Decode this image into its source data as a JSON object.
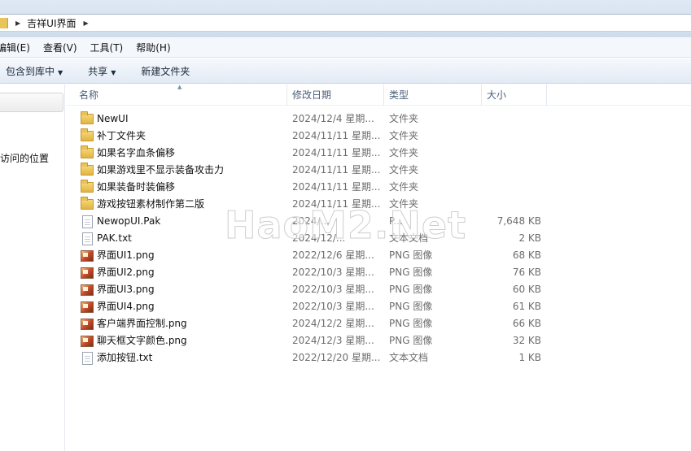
{
  "address": {
    "path": "吉祥UI界面"
  },
  "menu": [
    "编辑(E)",
    "查看(V)",
    "工具(T)",
    "帮助(H)"
  ],
  "toolbar": {
    "include_library": "包含到库中",
    "share": "共享",
    "new_folder": "新建文件夹"
  },
  "nav": {
    "recent_places": "访问的位置"
  },
  "columns": {
    "name": "名称",
    "date": "修改日期",
    "type": "类型",
    "size": "大小"
  },
  "files": [
    {
      "icon": "folder-icon",
      "name": "NewUI",
      "date": "2024/12/4 星期...",
      "type": "文件夹",
      "size": ""
    },
    {
      "icon": "folder-icon",
      "name": "补丁文件夹",
      "date": "2024/11/11 星期...",
      "type": "文件夹",
      "size": ""
    },
    {
      "icon": "folder-icon",
      "name": "如果名字血条偏移",
      "date": "2024/11/11 星期...",
      "type": "文件夹",
      "size": ""
    },
    {
      "icon": "folder-icon",
      "name": "如果游戏里不显示装备攻击力",
      "date": "2024/11/11 星期...",
      "type": "文件夹",
      "size": ""
    },
    {
      "icon": "folder-icon",
      "name": "如果装备时装偏移",
      "date": "2024/11/11 星期...",
      "type": "文件夹",
      "size": ""
    },
    {
      "icon": "folder-icon",
      "name": "游戏按钮素材制作第二版",
      "date": "2024/11/11 星期...",
      "type": "文件夹",
      "size": ""
    },
    {
      "icon": "file-icon",
      "name": "NewopUI.Pak",
      "date": "2024/...",
      "type": "P...",
      "size": "7,648 KB"
    },
    {
      "icon": "text-file-icon",
      "name": "PAK.txt",
      "date": "2024/12/...",
      "type": "文本文档",
      "size": "2 KB"
    },
    {
      "icon": "image-file-icon",
      "name": "界面UI1.png",
      "date": "2022/12/6 星期...",
      "type": "PNG 图像",
      "size": "68 KB"
    },
    {
      "icon": "image-file-icon",
      "name": "界面UI2.png",
      "date": "2022/10/3 星期...",
      "type": "PNG 图像",
      "size": "76 KB"
    },
    {
      "icon": "image-file-icon",
      "name": "界面UI3.png",
      "date": "2022/10/3 星期...",
      "type": "PNG 图像",
      "size": "60 KB"
    },
    {
      "icon": "image-file-icon",
      "name": "界面UI4.png",
      "date": "2022/10/3 星期...",
      "type": "PNG 图像",
      "size": "61 KB"
    },
    {
      "icon": "image-file-icon",
      "name": "客户端界面控制.png",
      "date": "2024/12/2 星期...",
      "type": "PNG 图像",
      "size": "66 KB"
    },
    {
      "icon": "image-file-icon",
      "name": "聊天框文字颜色.png",
      "date": "2024/12/3 星期...",
      "type": "PNG 图像",
      "size": "32 KB"
    },
    {
      "icon": "text-file-icon",
      "name": "添加按钮.txt",
      "date": "2022/12/20 星期...",
      "type": "文本文档",
      "size": "1 KB"
    }
  ],
  "watermark": "HaoM2.Net"
}
